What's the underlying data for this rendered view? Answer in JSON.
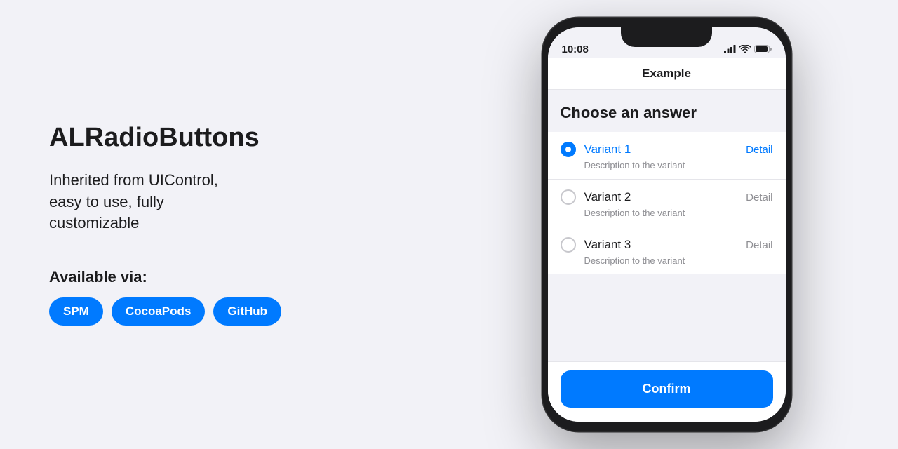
{
  "left": {
    "title": "ALRadioButtons",
    "description": "Inherited from UIControl,\neasy to use, fully\ncustomizable",
    "available_via": "Available via:",
    "badges": [
      {
        "label": "SPM"
      },
      {
        "label": "CocoaPods"
      },
      {
        "label": "GitHub"
      }
    ]
  },
  "phone": {
    "status": {
      "time": "10:08",
      "signal_dots": [
        4,
        6,
        8,
        10,
        12
      ],
      "wifi": "wifi",
      "battery": "battery"
    },
    "nav_title": "Example",
    "question": "Choose an answer",
    "options": [
      {
        "label": "Variant 1",
        "description": "Description to the variant",
        "detail": "Detail",
        "selected": true
      },
      {
        "label": "Variant 2",
        "description": "Description to the variant",
        "detail": "Detail",
        "selected": false
      },
      {
        "label": "Variant 3",
        "description": "Description to the variant",
        "detail": "Detail",
        "selected": false
      }
    ],
    "confirm_button": "Confirm"
  },
  "colors": {
    "accent": "#007aff"
  }
}
